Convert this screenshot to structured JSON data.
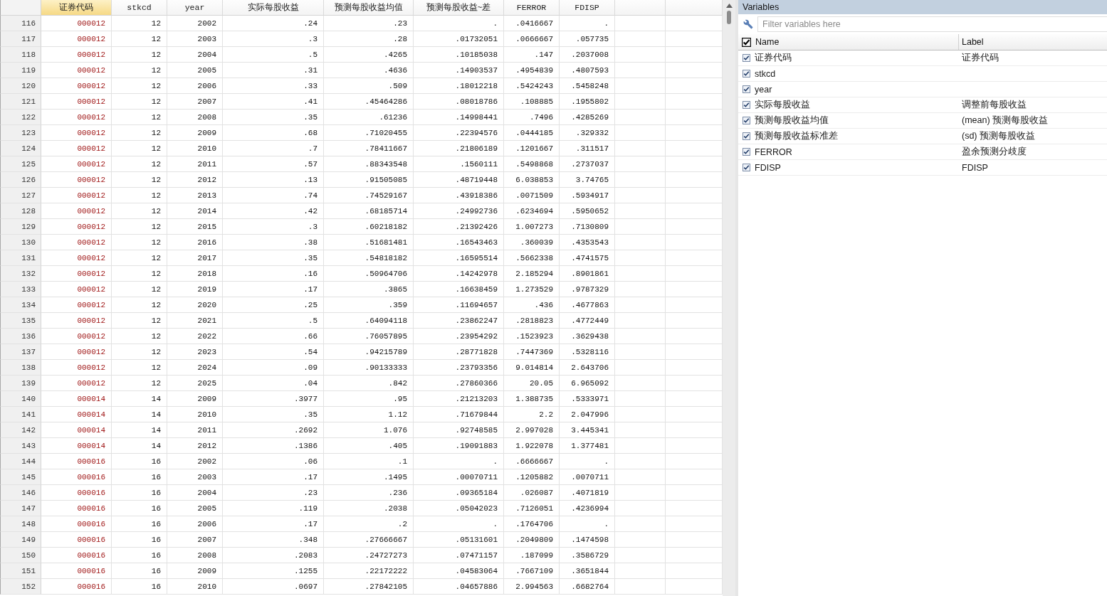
{
  "data_editor": {
    "columns": [
      {
        "label": "证券代码",
        "kind": "string",
        "selected": true
      },
      {
        "label": "stkcd",
        "kind": "numeric",
        "selected": false
      },
      {
        "label": "year",
        "kind": "numeric",
        "selected": false
      },
      {
        "label": "实际每股收益",
        "kind": "numeric",
        "selected": false
      },
      {
        "label": "预测每股收益均值",
        "kind": "numeric",
        "selected": false
      },
      {
        "label": "预测每股收益~差",
        "kind": "numeric",
        "selected": false
      },
      {
        "label": "FERROR",
        "kind": "numeric",
        "selected": false
      },
      {
        "label": "FDISP",
        "kind": "numeric",
        "selected": false
      }
    ],
    "rows": [
      {
        "number": "116",
        "cells": [
          "000012",
          "12",
          "2002",
          ".24",
          ".23",
          ".",
          ".0416667",
          "."
        ]
      },
      {
        "number": "117",
        "cells": [
          "000012",
          "12",
          "2003",
          ".3",
          ".28",
          ".01732051",
          ".0666667",
          ".057735"
        ]
      },
      {
        "number": "118",
        "cells": [
          "000012",
          "12",
          "2004",
          ".5",
          ".4265",
          ".10185038",
          ".147",
          ".2037008"
        ]
      },
      {
        "number": "119",
        "cells": [
          "000012",
          "12",
          "2005",
          ".31",
          ".4636",
          ".14903537",
          ".4954839",
          ".4807593"
        ]
      },
      {
        "number": "120",
        "cells": [
          "000012",
          "12",
          "2006",
          ".33",
          ".509",
          ".18012218",
          ".5424243",
          ".5458248"
        ]
      },
      {
        "number": "121",
        "cells": [
          "000012",
          "12",
          "2007",
          ".41",
          ".45464286",
          ".08018786",
          ".108885",
          ".1955802"
        ]
      },
      {
        "number": "122",
        "cells": [
          "000012",
          "12",
          "2008",
          ".35",
          ".61236",
          ".14998441",
          ".7496",
          ".4285269"
        ]
      },
      {
        "number": "123",
        "cells": [
          "000012",
          "12",
          "2009",
          ".68",
          ".71020455",
          ".22394576",
          ".0444185",
          ".329332"
        ]
      },
      {
        "number": "124",
        "cells": [
          "000012",
          "12",
          "2010",
          ".7",
          ".78411667",
          ".21806189",
          ".1201667",
          ".311517"
        ]
      },
      {
        "number": "125",
        "cells": [
          "000012",
          "12",
          "2011",
          ".57",
          ".88343548",
          ".1560111",
          ".5498868",
          ".2737037"
        ]
      },
      {
        "number": "126",
        "cells": [
          "000012",
          "12",
          "2012",
          ".13",
          ".91505085",
          ".48719448",
          "6.038853",
          "3.74765"
        ]
      },
      {
        "number": "127",
        "cells": [
          "000012",
          "12",
          "2013",
          ".74",
          ".74529167",
          ".43918386",
          ".0071509",
          ".5934917"
        ]
      },
      {
        "number": "128",
        "cells": [
          "000012",
          "12",
          "2014",
          ".42",
          ".68185714",
          ".24992736",
          ".6234694",
          ".5950652"
        ]
      },
      {
        "number": "129",
        "cells": [
          "000012",
          "12",
          "2015",
          ".3",
          ".60218182",
          ".21392426",
          "1.007273",
          ".7130809"
        ]
      },
      {
        "number": "130",
        "cells": [
          "000012",
          "12",
          "2016",
          ".38",
          ".51681481",
          ".16543463",
          ".360039",
          ".4353543"
        ]
      },
      {
        "number": "131",
        "cells": [
          "000012",
          "12",
          "2017",
          ".35",
          ".54818182",
          ".16595514",
          ".5662338",
          ".4741575"
        ]
      },
      {
        "number": "132",
        "cells": [
          "000012",
          "12",
          "2018",
          ".16",
          ".50964706",
          ".14242978",
          "2.185294",
          ".8901861"
        ]
      },
      {
        "number": "133",
        "cells": [
          "000012",
          "12",
          "2019",
          ".17",
          ".3865",
          ".16638459",
          "1.273529",
          ".9787329"
        ]
      },
      {
        "number": "134",
        "cells": [
          "000012",
          "12",
          "2020",
          ".25",
          ".359",
          ".11694657",
          ".436",
          ".4677863"
        ]
      },
      {
        "number": "135",
        "cells": [
          "000012",
          "12",
          "2021",
          ".5",
          ".64094118",
          ".23862247",
          ".2818823",
          ".4772449"
        ]
      },
      {
        "number": "136",
        "cells": [
          "000012",
          "12",
          "2022",
          ".66",
          ".76057895",
          ".23954292",
          ".1523923",
          ".3629438"
        ]
      },
      {
        "number": "137",
        "cells": [
          "000012",
          "12",
          "2023",
          ".54",
          ".94215789",
          ".28771828",
          ".7447369",
          ".5328116"
        ]
      },
      {
        "number": "138",
        "cells": [
          "000012",
          "12",
          "2024",
          ".09",
          ".90133333",
          ".23793356",
          "9.014814",
          "2.643706"
        ]
      },
      {
        "number": "139",
        "cells": [
          "000012",
          "12",
          "2025",
          ".04",
          ".842",
          ".27860366",
          "20.05",
          "6.965092"
        ]
      },
      {
        "number": "140",
        "cells": [
          "000014",
          "14",
          "2009",
          ".3977",
          ".95",
          ".21213203",
          "1.388735",
          ".5333971"
        ]
      },
      {
        "number": "141",
        "cells": [
          "000014",
          "14",
          "2010",
          ".35",
          "1.12",
          ".71679844",
          "2.2",
          "2.047996"
        ]
      },
      {
        "number": "142",
        "cells": [
          "000014",
          "14",
          "2011",
          ".2692",
          "1.076",
          ".92748585",
          "2.997028",
          "3.445341"
        ]
      },
      {
        "number": "143",
        "cells": [
          "000014",
          "14",
          "2012",
          ".1386",
          ".405",
          ".19091883",
          "1.922078",
          "1.377481"
        ]
      },
      {
        "number": "144",
        "cells": [
          "000016",
          "16",
          "2002",
          ".06",
          ".1",
          ".",
          ".6666667",
          "."
        ]
      },
      {
        "number": "145",
        "cells": [
          "000016",
          "16",
          "2003",
          ".17",
          ".1495",
          ".00070711",
          ".1205882",
          ".0070711"
        ]
      },
      {
        "number": "146",
        "cells": [
          "000016",
          "16",
          "2004",
          ".23",
          ".236",
          ".09365184",
          ".026087",
          ".4071819"
        ]
      },
      {
        "number": "147",
        "cells": [
          "000016",
          "16",
          "2005",
          ".119",
          ".2038",
          ".05042023",
          ".7126051",
          ".4236994"
        ]
      },
      {
        "number": "148",
        "cells": [
          "000016",
          "16",
          "2006",
          ".17",
          ".2",
          ".",
          ".1764706",
          "."
        ]
      },
      {
        "number": "149",
        "cells": [
          "000016",
          "16",
          "2007",
          ".348",
          ".27666667",
          ".05131601",
          ".2049809",
          ".1474598"
        ]
      },
      {
        "number": "150",
        "cells": [
          "000016",
          "16",
          "2008",
          ".2083",
          ".24727273",
          ".07471157",
          ".187099",
          ".3586729"
        ]
      },
      {
        "number": "151",
        "cells": [
          "000016",
          "16",
          "2009",
          ".1255",
          ".22172222",
          ".04583064",
          ".7667109",
          ".3651844"
        ]
      },
      {
        "number": "152",
        "cells": [
          "000016",
          "16",
          "2010",
          ".0697",
          ".27842105",
          ".04657886",
          "2.994563",
          ".6682764"
        ]
      }
    ]
  },
  "variables_panel": {
    "title": "Variables",
    "filter": {
      "placeholder": "Filter variables here"
    },
    "header": {
      "checked": true,
      "columns": [
        "Name",
        "Label"
      ]
    },
    "variables": [
      {
        "name": "证券代码",
        "label": "证券代码",
        "checked": true
      },
      {
        "name": "stkcd",
        "checked": true
      },
      {
        "name": "year",
        "checked": true
      },
      {
        "name": "实际每股收益",
        "label": "调整前每股收益",
        "checked": true
      },
      {
        "name": "预测每股收益均值",
        "label": "(mean) 预测每股收益",
        "checked": true
      },
      {
        "name": "预测每股收益标准差",
        "label": "(sd) 预测每股收益",
        "checked": true
      },
      {
        "name": "FERROR",
        "label": "盈余预测分歧度",
        "checked": true
      },
      {
        "name": "FDISP",
        "label": "FDISP",
        "checked": true
      }
    ]
  }
}
